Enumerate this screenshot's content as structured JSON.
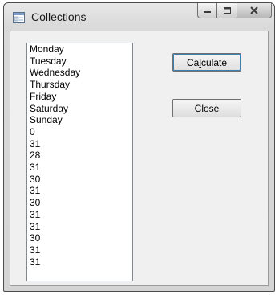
{
  "window": {
    "title": "Collections"
  },
  "list": {
    "items": [
      "Monday",
      "Tuesday",
      "Wednesday",
      "Thursday",
      "Friday",
      "Saturday",
      "Sunday",
      "0",
      "31",
      "28",
      "31",
      "30",
      "31",
      "30",
      "31",
      "31",
      "30",
      "31",
      "31"
    ]
  },
  "buttons": {
    "calculate": {
      "pre": "Ca",
      "access": "l",
      "post": "culate"
    },
    "close": {
      "pre": "",
      "access": "C",
      "post": "lose"
    }
  }
}
